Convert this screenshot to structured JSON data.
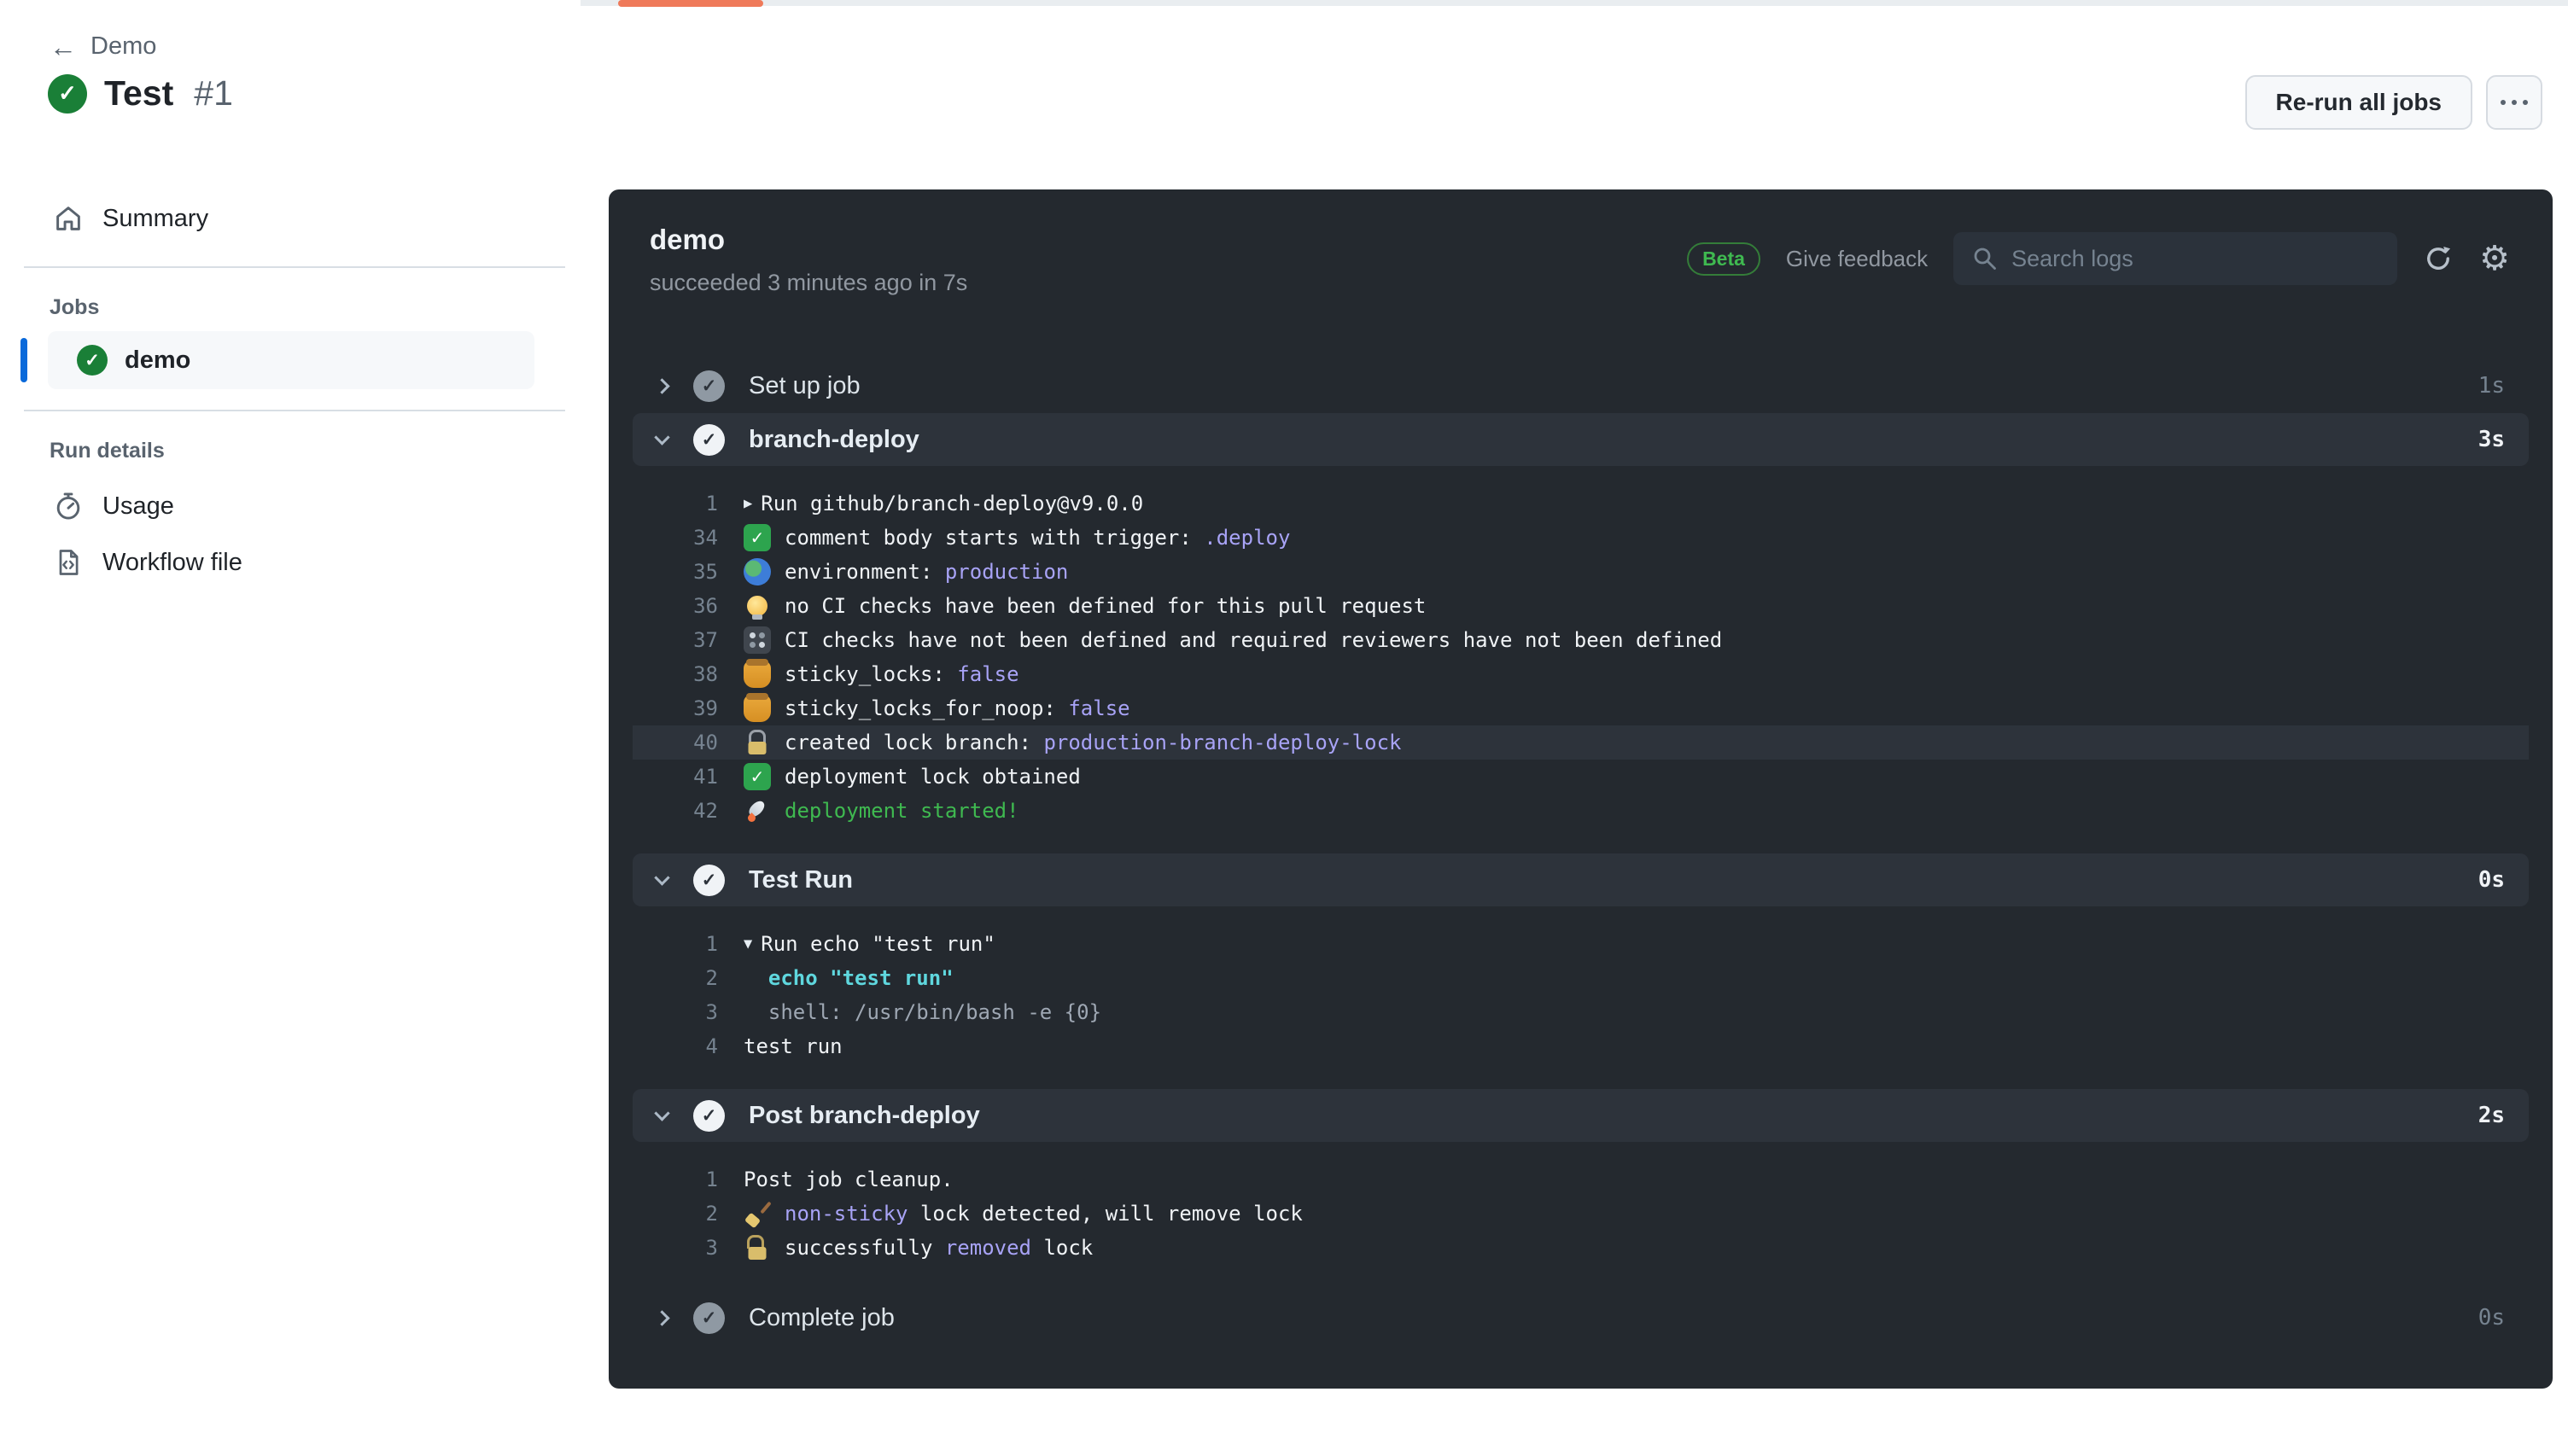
{
  "page": {
    "loading_bar": {
      "track_color": "#e9edf0",
      "thumb_color": "#ef7a5a"
    }
  },
  "sidebar": {
    "back_label": "Demo",
    "back_arrow": "←",
    "run_title": "Test",
    "run_number": "#1",
    "summary_label": "Summary",
    "jobs_section_label": "Jobs",
    "jobs": [
      {
        "label": "demo",
        "status": "success",
        "selected": true
      }
    ],
    "run_details_label": "Run details",
    "run_details": [
      {
        "label": "Usage",
        "icon": "stopwatch-icon"
      },
      {
        "label": "Workflow file",
        "icon": "file-code-icon"
      }
    ]
  },
  "header": {
    "rerun_button_label": "Re-run all jobs",
    "more_button_label": "⋯"
  },
  "log_panel": {
    "job_name": "demo",
    "job_status_line": "succeeded 3 minutes ago in 7s",
    "beta_badge": "Beta",
    "feedback_label": "Give feedback",
    "search_placeholder": "Search logs",
    "sections": [
      {
        "title": "Set up job",
        "duration": "1s",
        "expanded": false,
        "status": "success",
        "lines": []
      },
      {
        "title": "branch-deploy",
        "duration": "3s",
        "expanded": true,
        "status": "success",
        "lines": [
          {
            "num": "1",
            "prefix": "▶",
            "icon": null,
            "glyph": null,
            "highlight": false,
            "segments": [
              {
                "text": "Run github/branch-deploy@v9.0.0",
                "style": "white"
              }
            ]
          },
          {
            "num": "34",
            "prefix": null,
            "icon": "check",
            "glyph": "✅",
            "highlight": false,
            "segments": [
              {
                "text": "comment body starts with trigger: ",
                "style": "white"
              },
              {
                "text": ".deploy",
                "style": "purple"
              }
            ]
          },
          {
            "num": "35",
            "prefix": null,
            "icon": "globe",
            "glyph": "🌎",
            "highlight": false,
            "segments": [
              {
                "text": "environment: ",
                "style": "white"
              },
              {
                "text": "production",
                "style": "purple"
              }
            ]
          },
          {
            "num": "36",
            "prefix": null,
            "icon": "bulb",
            "glyph": "💡",
            "highlight": false,
            "segments": [
              {
                "text": "no CI checks have been defined for this pull request",
                "style": "white"
              }
            ]
          },
          {
            "num": "37",
            "prefix": null,
            "icon": "knobs",
            "glyph": "🎛️",
            "highlight": false,
            "segments": [
              {
                "text": "CI checks have not been defined and required reviewers have not been defined",
                "style": "white"
              }
            ]
          },
          {
            "num": "38",
            "prefix": null,
            "icon": "honey",
            "glyph": "🍯",
            "highlight": false,
            "segments": [
              {
                "text": "sticky_locks: ",
                "style": "white"
              },
              {
                "text": "false",
                "style": "purple"
              }
            ]
          },
          {
            "num": "39",
            "prefix": null,
            "icon": "honey",
            "glyph": "🍯",
            "highlight": false,
            "segments": [
              {
                "text": "sticky_locks_for_noop: ",
                "style": "white"
              },
              {
                "text": "false",
                "style": "purple"
              }
            ]
          },
          {
            "num": "40",
            "prefix": null,
            "icon": "lock",
            "glyph": "🔒",
            "highlight": true,
            "segments": [
              {
                "text": "created lock branch: ",
                "style": "white"
              },
              {
                "text": "production-branch-deploy-lock",
                "style": "purple"
              }
            ]
          },
          {
            "num": "41",
            "prefix": null,
            "icon": "check",
            "glyph": "✅",
            "highlight": false,
            "segments": [
              {
                "text": "deployment lock obtained",
                "style": "white"
              }
            ]
          },
          {
            "num": "42",
            "prefix": null,
            "icon": "rocket",
            "glyph": "🚀",
            "highlight": false,
            "segments": [
              {
                "text": "deployment started!",
                "style": "green"
              }
            ]
          }
        ]
      },
      {
        "title": "Test Run",
        "duration": "0s",
        "expanded": true,
        "status": "success",
        "lines": [
          {
            "num": "1",
            "prefix": "▼",
            "icon": null,
            "glyph": null,
            "highlight": false,
            "segments": [
              {
                "text": "Run echo \"test run\"",
                "style": "white"
              }
            ]
          },
          {
            "num": "2",
            "prefix": null,
            "icon": null,
            "glyph": null,
            "highlight": false,
            "segments": [
              {
                "text": "  ",
                "style": "white"
              },
              {
                "text": "echo \"test run\"",
                "style": "cyan"
              }
            ]
          },
          {
            "num": "3",
            "prefix": null,
            "icon": null,
            "glyph": null,
            "highlight": false,
            "segments": [
              {
                "text": "  shell: /usr/bin/bash -e {0}",
                "style": "gray"
              }
            ]
          },
          {
            "num": "4",
            "prefix": null,
            "icon": null,
            "glyph": null,
            "highlight": false,
            "segments": [
              {
                "text": "test run",
                "style": "white"
              }
            ]
          }
        ]
      },
      {
        "title": "Post branch-deploy",
        "duration": "2s",
        "expanded": true,
        "status": "success",
        "lines": [
          {
            "num": "1",
            "prefix": null,
            "icon": null,
            "glyph": null,
            "highlight": false,
            "segments": [
              {
                "text": "Post job cleanup.",
                "style": "white"
              }
            ]
          },
          {
            "num": "2",
            "prefix": null,
            "icon": "broom",
            "glyph": "🧹",
            "highlight": false,
            "segments": [
              {
                "text": "non-sticky",
                "style": "purple"
              },
              {
                "text": " lock detected, will remove lock",
                "style": "white"
              }
            ]
          },
          {
            "num": "3",
            "prefix": null,
            "icon": "unlock",
            "glyph": "🔓",
            "highlight": false,
            "segments": [
              {
                "text": "successfully ",
                "style": "white"
              },
              {
                "text": "removed",
                "style": "purple"
              },
              {
                "text": " lock",
                "style": "white"
              }
            ]
          }
        ]
      },
      {
        "title": "Complete job",
        "duration": "0s",
        "expanded": false,
        "status": "success",
        "lines": []
      }
    ]
  },
  "colors": {
    "accent_blue": "#0969da",
    "success_green": "#1a7f37",
    "panel_bg": "#24292f",
    "panel_row_highlight": "#2d333b",
    "log_purple": "#a8a3f6",
    "log_green": "#3fb950",
    "log_cyan": "#5fd7de",
    "beta_green": "#3fb950",
    "loading_orange": "#ef7a5a"
  }
}
